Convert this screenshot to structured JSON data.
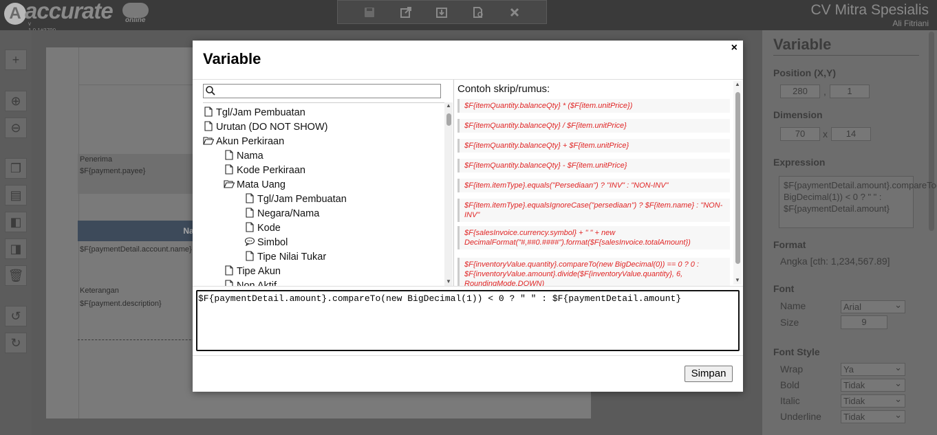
{
  "app": {
    "logo_text": "accurate",
    "logo_online": "online",
    "version": "v 1.0.1#3790",
    "company": "CV Mitra Spesialis",
    "user": "Ali Fitriani"
  },
  "toolbar_icons": [
    "save-icon",
    "export-icon",
    "download-icon",
    "preview-icon",
    "close-icon"
  ],
  "left_tools": [
    "add-icon",
    "zoom-in-icon",
    "zoom-out-icon",
    "copy-icon",
    "paste-icon",
    "bring-front-icon",
    "send-back-icon",
    "delete-icon",
    "undo-icon",
    "redo-icon"
  ],
  "background": {
    "penerima_label": "Penerima",
    "penerima_value": "$F{payment.payee}",
    "nama_header": "Nama",
    "account_value": "$F{paymentDetail.account.name}",
    "keterangan_label": "Keterangan",
    "description_value": "$F{payment.description}"
  },
  "panel": {
    "title": "Variable",
    "position_label": "Position (X,Y)",
    "pos_x": "280",
    "pos_y": "1",
    "dimension_label": "Dimension",
    "dim_w": "70",
    "dim_h": "14",
    "expression_label": "Expression",
    "expression_value": "$F{paymentDetail.amount}.compareTo(new BigDecimal(1)) < 0 ? \" \" : $F{paymentDetail.amount}",
    "format_label": "Format",
    "format_value": "Angka [cth: 1,234,567.89]",
    "font_label": "Font",
    "font_name_label": "Name",
    "font_name_value": "Arial",
    "font_size_label": "Size",
    "font_size_value": "9",
    "font_style_label": "Font Style",
    "wrap_label": "Wrap",
    "wrap_value": "Ya",
    "bold_label": "Bold",
    "bold_value": "Tidak",
    "italic_label": "Italic",
    "italic_value": "Tidak",
    "underline_label": "Underline",
    "underline_value": "Tidak",
    "comma_sep": ",",
    "x_sep": "x"
  },
  "modal": {
    "title": "Variable",
    "close_label": "×",
    "search_placeholder": "",
    "tree": [
      {
        "label": "Tgl/Jam Pembuatan",
        "icon": "file-icon",
        "level": 0
      },
      {
        "label": "Urutan (DO NOT SHOW)",
        "icon": "file-icon",
        "level": 0
      },
      {
        "label": "Akun Perkiraan",
        "icon": "folder-open-icon",
        "level": 0
      },
      {
        "label": "Nama",
        "icon": "file-icon",
        "level": 1
      },
      {
        "label": "Kode Perkiraan",
        "icon": "file-icon",
        "level": 1
      },
      {
        "label": "Mata Uang",
        "icon": "folder-open-icon",
        "level": 1
      },
      {
        "label": "Tgl/Jam Pembuatan",
        "icon": "file-icon",
        "level": 2
      },
      {
        "label": "Negara/Nama",
        "icon": "file-icon",
        "level": 2
      },
      {
        "label": "Kode",
        "icon": "file-icon",
        "level": 2
      },
      {
        "label": "Simbol",
        "icon": "comment-icon",
        "level": 2
      },
      {
        "label": "Tipe Nilai Tukar",
        "icon": "file-icon",
        "level": 2
      },
      {
        "label": "Tipe Akun",
        "icon": "file-icon",
        "level": 1
      },
      {
        "label": "Non Aktif",
        "icon": "file-icon",
        "level": 1
      }
    ],
    "examples_title": "Contoh skrip/rumus:",
    "examples": [
      "$F{itemQuantity.balanceQty} * ($F{item.unitPrice})",
      "$F{itemQuantity.balanceQty} / $F{item.unitPrice}",
      "$F{itemQuantity.balanceQty} + $F{item.unitPrice}",
      "$F{itemQuantity.balanceQty} - $F{item.unitPrice}",
      "$F{item.itemType}.equals(\"Persediaan\") ? \"INV\" : \"NON-INV\"",
      "$F{item.itemType}.equalsIgnoreCase(\"persediaan\") ? $F{item.name} : \"NON-INV\"",
      "$F{salesInvoice.currency.symbol} + \" \" + new DecimalFormat(\"#,##0.####\").format($F{salesInvoice.totalAmount})",
      "$F{inventoryValue.quantity}.compareTo(new BigDecimal(0)) == 0 ? 0 : $F{inventoryValue.amount}.divide($F{inventoryValue.quantity}, 6, RoundingMode.DOWN)"
    ],
    "editor_value": "$F{paymentDetail.amount}.compareTo(new BigDecimal(1)) < 0 ? \" \" : $F{paymentDetail.amount}",
    "save_label": "Simpan"
  }
}
